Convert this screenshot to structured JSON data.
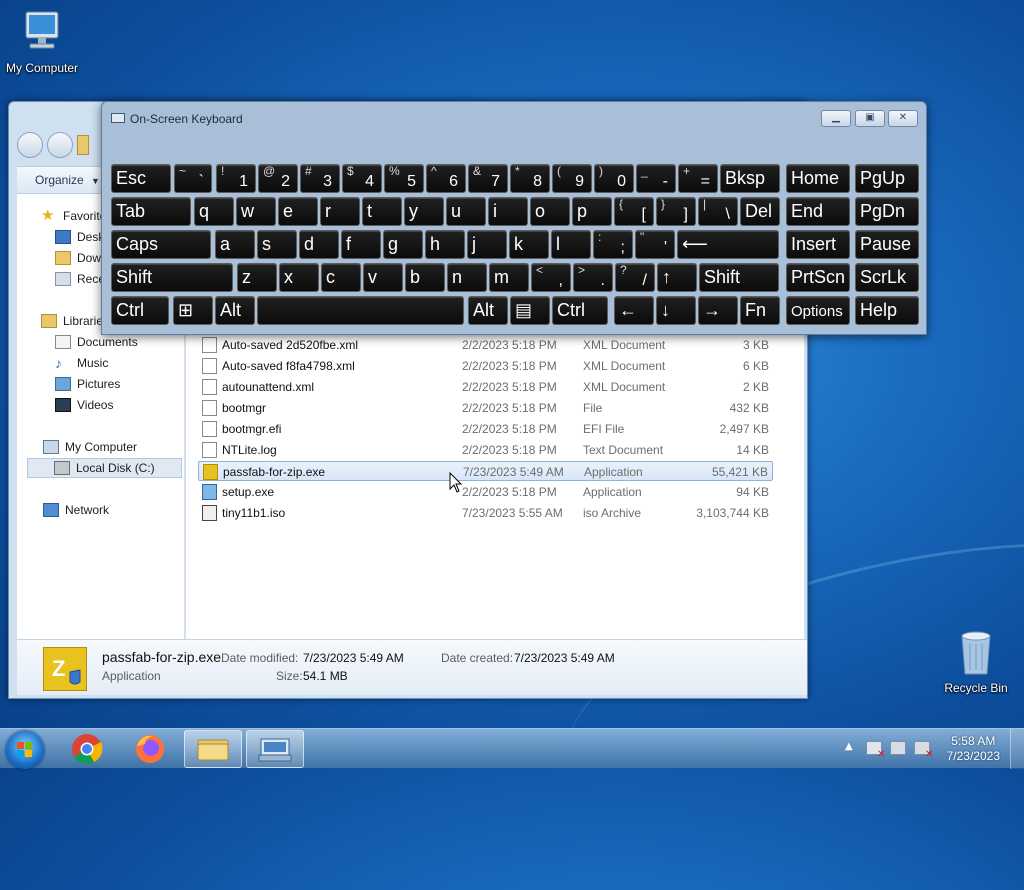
{
  "desktop": {
    "icons": [
      {
        "label": "My Computer"
      },
      {
        "label": "Recycle Bin"
      }
    ]
  },
  "osk": {
    "title": "On-Screen Keyboard",
    "rows": [
      [
        {
          "k": "Esc"
        },
        {
          "s": "~",
          "b": "`"
        },
        {
          "s": "!",
          "b": "1"
        },
        {
          "s": "@",
          "b": "2"
        },
        {
          "s": "#",
          "b": "3"
        },
        {
          "s": "$",
          "b": "4"
        },
        {
          "s": "%",
          "b": "5"
        },
        {
          "s": "^",
          "b": "6"
        },
        {
          "s": "&",
          "b": "7"
        },
        {
          "s": "*",
          "b": "8"
        },
        {
          "s": "(",
          "b": "9"
        },
        {
          "s": ")",
          "b": "0"
        },
        {
          "s": "_",
          "b": "-"
        },
        {
          "s": "+",
          "b": "="
        },
        {
          "k": "Bksp"
        },
        {
          "k": "Home"
        },
        {
          "k": "PgUp"
        }
      ],
      [
        {
          "k": "Tab"
        },
        {
          "k": "q"
        },
        {
          "k": "w"
        },
        {
          "k": "e"
        },
        {
          "k": "r"
        },
        {
          "k": "t"
        },
        {
          "k": "y"
        },
        {
          "k": "u"
        },
        {
          "k": "i"
        },
        {
          "k": "o"
        },
        {
          "k": "p"
        },
        {
          "s": "{",
          "b": "["
        },
        {
          "s": "}",
          "b": "]"
        },
        {
          "s": "|",
          "b": "\\"
        },
        {
          "k": "Del"
        },
        {
          "k": "End"
        },
        {
          "k": "PgDn"
        }
      ],
      [
        {
          "k": "Caps"
        },
        {
          "k": "a"
        },
        {
          "k": "s"
        },
        {
          "k": "d"
        },
        {
          "k": "f"
        },
        {
          "k": "g"
        },
        {
          "k": "h"
        },
        {
          "k": "j"
        },
        {
          "k": "k"
        },
        {
          "k": "l"
        },
        {
          "s": ":",
          "b": ";"
        },
        {
          "s": "\"",
          "b": "'"
        },
        {
          "k": "⟵"
        },
        {
          "k": "Insert"
        },
        {
          "k": "Pause"
        }
      ],
      [
        {
          "k": "Shift"
        },
        {
          "k": "z"
        },
        {
          "k": "x"
        },
        {
          "k": "c"
        },
        {
          "k": "v"
        },
        {
          "k": "b"
        },
        {
          "k": "n"
        },
        {
          "k": "m"
        },
        {
          "s": "<",
          "b": ","
        },
        {
          "s": ">",
          "b": "."
        },
        {
          "s": "?",
          "b": "/"
        },
        {
          "k": "↑"
        },
        {
          "k": "Shift"
        },
        {
          "k": "PrtScn"
        },
        {
          "k": "ScrLk"
        }
      ],
      [
        {
          "k": "Ctrl"
        },
        {
          "k": "⊞"
        },
        {
          "k": "Alt"
        },
        {
          "k": ""
        },
        {
          "k": "Alt"
        },
        {
          "k": "▤"
        },
        {
          "k": "Ctrl"
        },
        {
          "k": "←"
        },
        {
          "k": "↓"
        },
        {
          "k": "→"
        },
        {
          "k": "Fn"
        },
        {
          "k": "Options"
        },
        {
          "k": "Help"
        }
      ]
    ]
  },
  "explorer": {
    "organize_label": "Organize",
    "nav": [
      {
        "label": "Favorites"
      },
      {
        "label": "Desktop"
      },
      {
        "label": "Downloads"
      },
      {
        "label": "Recent Places"
      },
      {
        "label": "Libraries"
      },
      {
        "label": "Documents"
      },
      {
        "label": "Music"
      },
      {
        "label": "Pictures"
      },
      {
        "label": "Videos"
      },
      {
        "label": "My Computer"
      },
      {
        "label": "Local Disk (C:)"
      },
      {
        "label": "Network"
      }
    ],
    "files": [
      {
        "name": "Auto-saved 2d520fbe.xml",
        "date": "2/2/2023 5:18 PM",
        "type": "XML Document",
        "size": "3 KB",
        "icon": "xml"
      },
      {
        "name": "Auto-saved f8fa4798.xml",
        "date": "2/2/2023 5:18 PM",
        "type": "XML Document",
        "size": "6 KB",
        "icon": "xml"
      },
      {
        "name": "autounattend.xml",
        "date": "2/2/2023 5:18 PM",
        "type": "XML Document",
        "size": "2 KB",
        "icon": "xml"
      },
      {
        "name": "bootmgr",
        "date": "2/2/2023 5:18 PM",
        "type": "File",
        "size": "432 KB",
        "icon": "file"
      },
      {
        "name": "bootmgr.efi",
        "date": "2/2/2023 5:18 PM",
        "type": "EFI File",
        "size": "2,497 KB",
        "icon": "file"
      },
      {
        "name": "NTLite.log",
        "date": "2/2/2023 5:18 PM",
        "type": "Text Document",
        "size": "14 KB",
        "icon": "file"
      },
      {
        "name": "passfab-for-zip.exe",
        "date": "7/23/2023 5:49 AM",
        "type": "Application",
        "size": "55,421 KB",
        "icon": "zip-exe",
        "selected": true
      },
      {
        "name": "setup.exe",
        "date": "2/2/2023 5:18 PM",
        "type": "Application",
        "size": "94 KB",
        "icon": "setup"
      },
      {
        "name": "tiny11b1.iso",
        "date": "7/23/2023 5:55 AM",
        "type": "iso Archive",
        "size": "3,103,744 KB",
        "icon": "iso"
      }
    ],
    "details": {
      "name": "passfab-for-zip.exe",
      "type": "Application",
      "modified_label": "Date modified:",
      "modified": "7/23/2023 5:49 AM",
      "created_label": "Date created:",
      "created": "7/23/2023 5:49 AM",
      "size_label": "Size:",
      "size": "54.1 MB"
    }
  },
  "taskbar": {
    "time": "5:58 AM",
    "date": "7/23/2023"
  }
}
